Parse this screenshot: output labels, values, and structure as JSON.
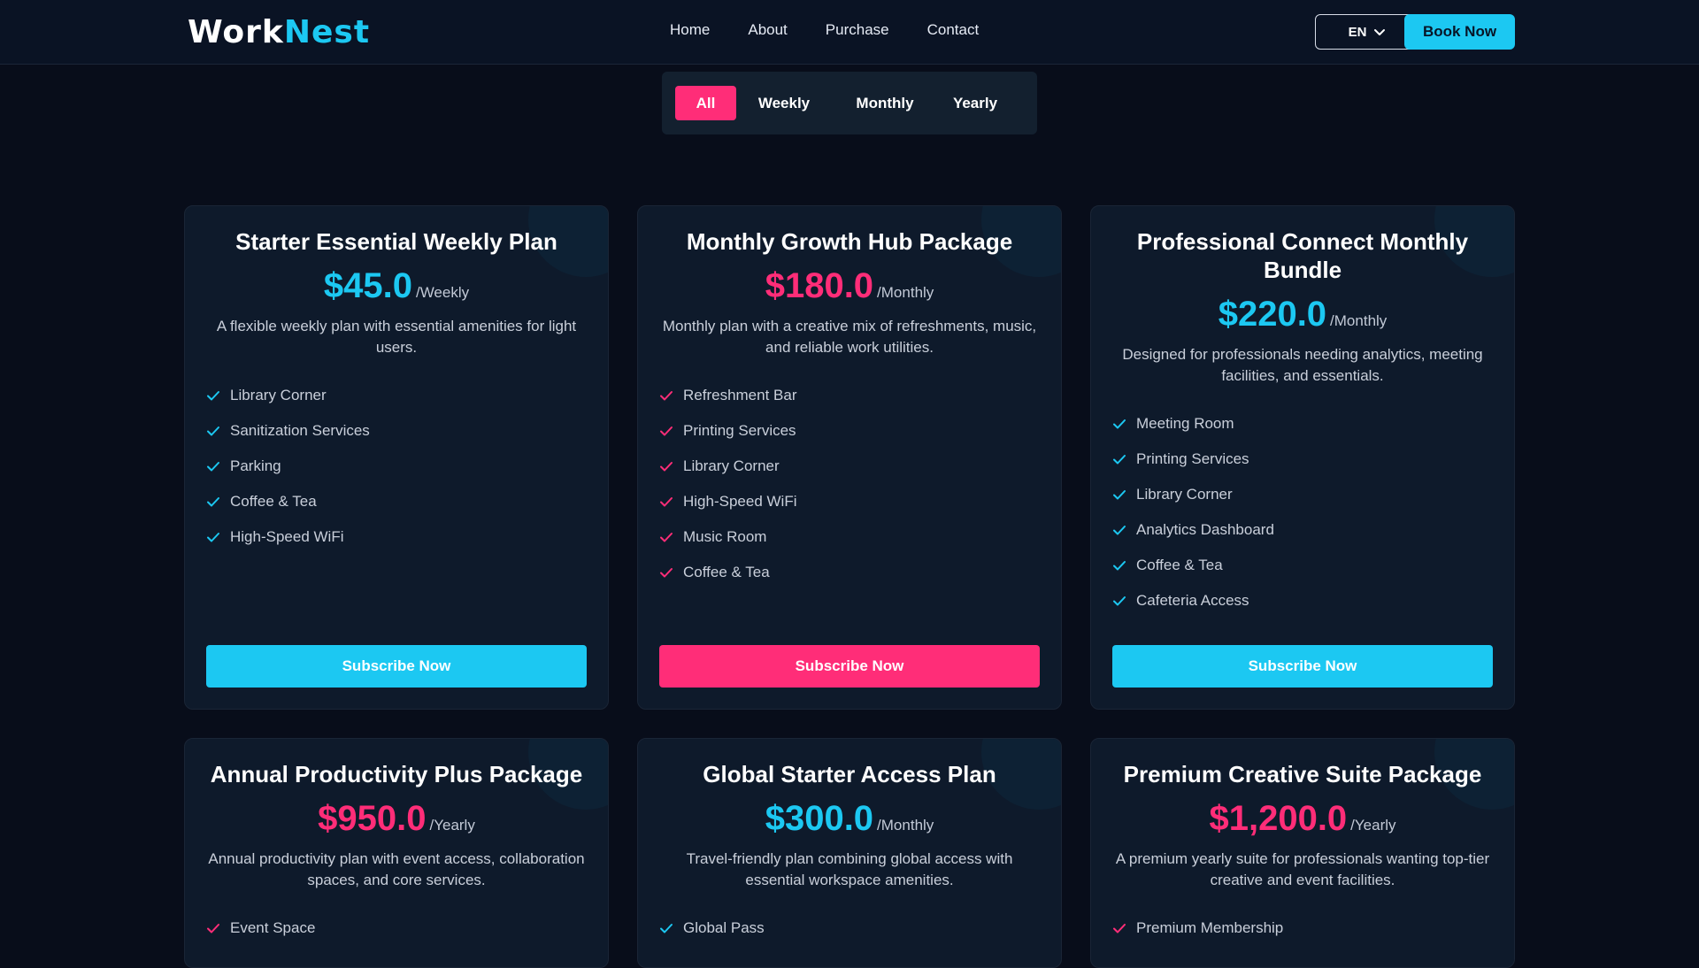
{
  "brand": {
    "logo_part1": "Work",
    "logo_part2": "Nest",
    "primary_color": "#1cc8f2",
    "accent_color": "#ff2d78"
  },
  "nav": {
    "links": [
      "Home",
      "About",
      "Purchase",
      "Contact"
    ],
    "language": "EN",
    "language_icon": "chevron-down-icon",
    "book_label": "Book Now"
  },
  "filters": {
    "tabs": [
      "All",
      "Weekly",
      "Monthly",
      "Yearly"
    ],
    "active": "All"
  },
  "plans": [
    {
      "title": "Starter Essential Weekly Plan",
      "price": "$45.0",
      "period": "/Weekly",
      "description": "A flexible weekly plan with essential amenities for light users.",
      "features": [
        "Library Corner",
        "Sanitization Services",
        "Parking",
        "Coffee & Tea",
        "High-Speed WiFi"
      ],
      "button_label": "Subscribe Now",
      "accent": "#1cc8f2"
    },
    {
      "title": "Monthly Growth Hub Package",
      "price": "$180.0",
      "period": "/Monthly",
      "description": "Monthly plan with a creative mix of refreshments, music, and reliable work utilities.",
      "features": [
        "Refreshment Bar",
        "Printing Services",
        "Library Corner",
        "High-Speed WiFi",
        "Music Room",
        "Coffee & Tea"
      ],
      "button_label": "Subscribe Now",
      "accent": "#ff2d78"
    },
    {
      "title": "Professional Connect Monthly Bundle",
      "price": "$220.0",
      "period": "/Monthly",
      "description": "Designed for professionals needing analytics, meeting facilities, and essentials.",
      "features": [
        "Meeting Room",
        "Printing Services",
        "Library Corner",
        "Analytics Dashboard",
        "Coffee & Tea",
        "Cafeteria Access"
      ],
      "button_label": "Subscribe Now",
      "accent": "#1cc8f2"
    },
    {
      "title": "Annual Productivity Plus Package",
      "price": "$950.0",
      "period": "/Yearly",
      "description": "Annual productivity plan with event access, collaboration spaces, and core services.",
      "features": [
        "Event Space"
      ],
      "button_label": "",
      "accent": "#ff2d78"
    },
    {
      "title": "Global Starter Access Plan",
      "price": "$300.0",
      "period": "/Monthly",
      "description": "Travel-friendly plan combining global access with essential workspace amenities.",
      "features": [
        "Global Pass"
      ],
      "button_label": "",
      "accent": "#1cc8f2"
    },
    {
      "title": "Premium Creative Suite Package",
      "price": "$1,200.0",
      "period": "/Yearly",
      "description": "A premium yearly suite for professionals wanting top-tier creative and event facilities.",
      "features": [
        "Premium Membership"
      ],
      "button_label": "",
      "accent": "#ff2d78"
    }
  ]
}
